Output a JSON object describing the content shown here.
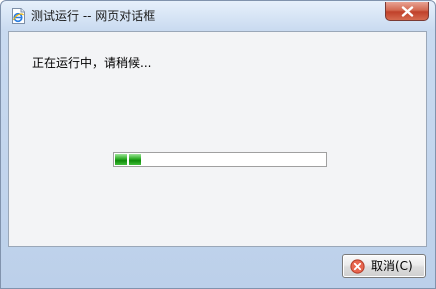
{
  "window": {
    "title": "测试运行 -- 网页对话框",
    "icon": "ie-page-icon"
  },
  "titlebar": {
    "close_icon": "close-icon"
  },
  "content": {
    "message": "正在运行中，请稍候..."
  },
  "progress": {
    "chunks_filled": 2,
    "style": "marquee",
    "color": "#1fa21a"
  },
  "footer": {
    "cancel_label": "取消(C)",
    "cancel_icon": "cancel-x-icon"
  }
}
